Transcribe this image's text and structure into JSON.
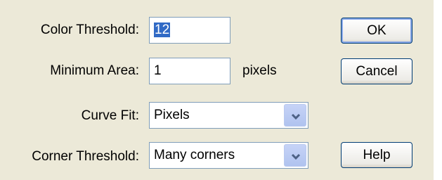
{
  "fields": {
    "color_threshold": {
      "label": "Color Threshold:",
      "value": "12"
    },
    "minimum_area": {
      "label": "Minimum Area:",
      "value": "1",
      "unit": "pixels"
    },
    "curve_fit": {
      "label": "Curve Fit:",
      "value": "Pixels"
    },
    "corner_threshold": {
      "label": "Corner Threshold:",
      "value": "Many corners"
    }
  },
  "buttons": {
    "ok": "OK",
    "cancel": "Cancel",
    "help": "Help"
  },
  "icons": {
    "dropdown": "chevron-down-icon"
  },
  "colors": {
    "dialog_bg": "#ece9d8",
    "selection": "#316ac5",
    "field_border": "#7f9db9"
  }
}
